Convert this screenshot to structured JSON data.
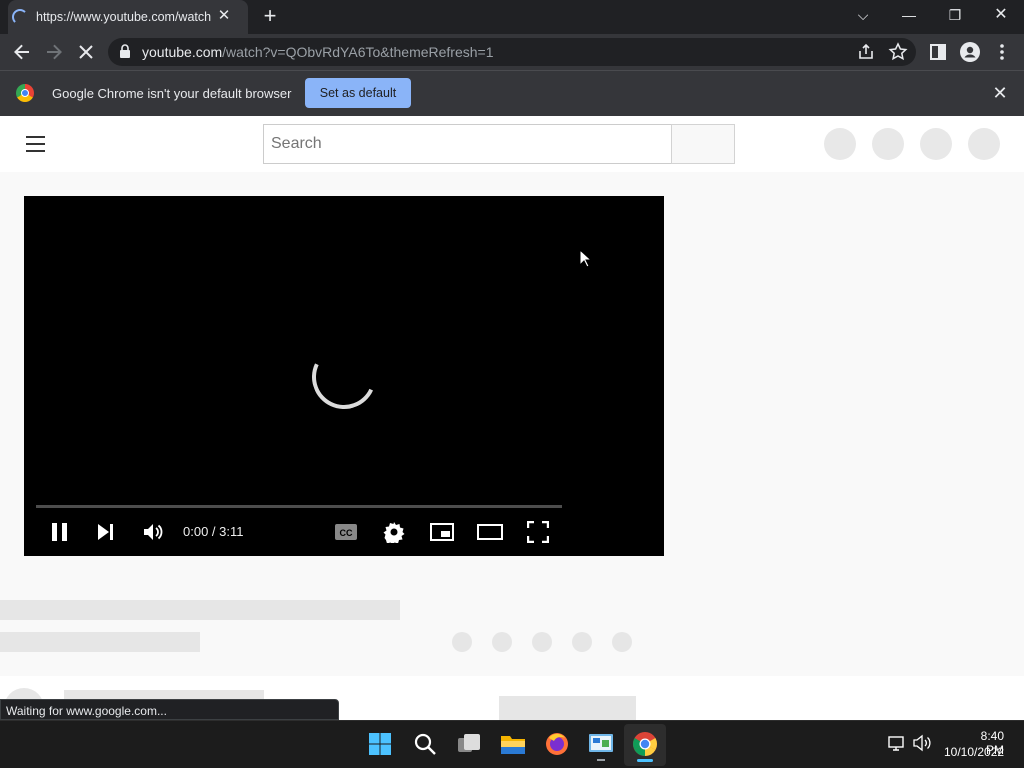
{
  "browser": {
    "tab_title": "https://www.youtube.com/watch",
    "url_host": "youtube.com",
    "url_path": "/watch?v=QObvRdYA6To&themeRefresh=1",
    "tab_close": "✕",
    "new_tab": "+",
    "window_controls": {
      "dropdown": "⌵",
      "minimize": "—",
      "restore": "❐",
      "close": "✕"
    }
  },
  "infobar": {
    "message": "Google Chrome isn't your default browser",
    "button_label": "Set as default",
    "close": "✕"
  },
  "youtube": {
    "search_placeholder": "Search"
  },
  "player": {
    "time": "0:00 / 3:11",
    "progress": 0
  },
  "status_bar": {
    "text": "Waiting for www.google.com..."
  },
  "taskbar": {
    "time": "8:40 PM",
    "date": "10/10/2022",
    "apps": [
      "start-icon",
      "search-icon",
      "task-view-icon",
      "file-explorer-icon",
      "firefox-icon",
      "control-panel-icon",
      "chrome-icon"
    ]
  },
  "colors": {
    "accent": "#8ab4f8",
    "chrome_dark": "#35363a",
    "tab_strip": "#202124"
  }
}
